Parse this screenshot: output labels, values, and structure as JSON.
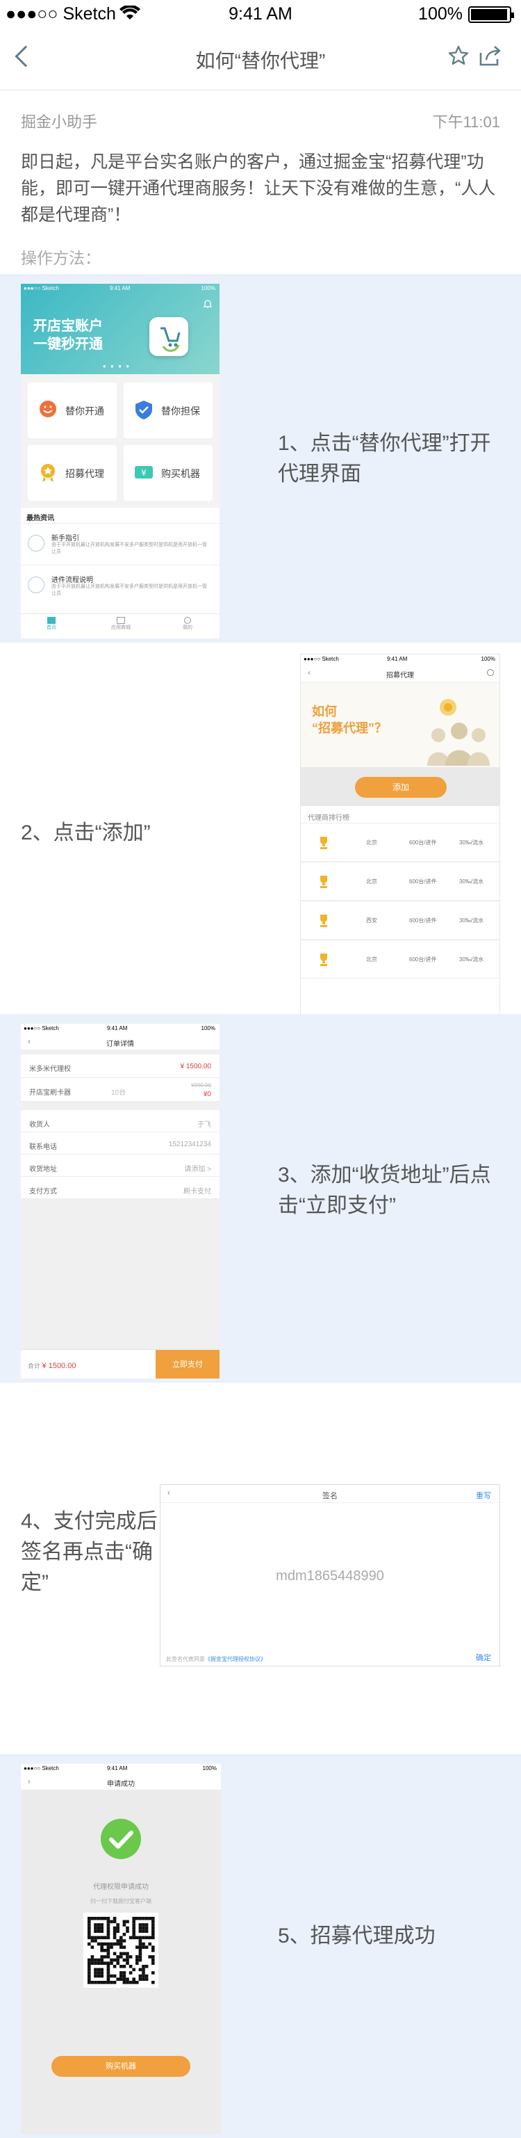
{
  "status_bar": {
    "carrier": "●●●○○ Sketch",
    "time": "9:41 AM",
    "battery": "100%"
  },
  "nav": {
    "title": "如何“替你代理”"
  },
  "article": {
    "author": "掘金小助手",
    "time": "下午11:01",
    "intro": "即日起，凡是平台实名账户的客户，通过掘金宝“招募代理”功能，即可一键开通代理商服务！让天下没有难做的生意，“人人都是代理商”！",
    "howto": "操作方法："
  },
  "colors": {
    "accent": "#f0a03c",
    "bg_blue": "#eaf1fb",
    "teal": "#5ec4c2"
  },
  "steps": [
    {
      "caption": "1、点击“替你代理”打开代理界面"
    },
    {
      "caption": "2、点击“添加”"
    },
    {
      "caption": "3、添加“收货地址”后点击“立即支付”"
    },
    {
      "caption": "4、支付完成后签名再点击“确定”"
    },
    {
      "caption": "5、招募代理成功"
    }
  ],
  "s1": {
    "status_left": "●●●○○ Sketch",
    "status_time": "9:41 AM",
    "status_right": "100%",
    "banner1": "开店宝账户",
    "banner2": "一键秒开通",
    "tiles": [
      "替你开通",
      "替你担保",
      "招募代理",
      "购买机器"
    ],
    "news_title": "最热资讯",
    "news": [
      {
        "title": "新手指引",
        "text": "由于平开放机最让开放机构发展不安多户服类型时是供机是用开放机一管让员"
      },
      {
        "title": "进件流程说明",
        "text": "由于平开放机最让开放机构发展不安多户服类型时是供机是用开放机一管让员"
      }
    ],
    "tabs": [
      "首页",
      "应用商城",
      "我的"
    ]
  },
  "s2": {
    "status_left": "●●●○○ Sketch",
    "status_time": "9:41 AM",
    "status_right": "100%",
    "title": "招募代理",
    "hero1": "如何",
    "hero2": "“招募代理”？",
    "add": "添加",
    "list_title": "代理商排行榜",
    "rows": [
      [
        "北京",
        "600台/进件",
        "30‰/流水"
      ],
      [
        "北京",
        "600台/进件",
        "30‰/流水"
      ],
      [
        "西安",
        "600台/进件",
        "30‰/流水"
      ],
      [
        "北京",
        "600台/进件",
        "30‰/流水"
      ]
    ]
  },
  "s3": {
    "status_left": "●●●○○ Sketch",
    "status_time": "9:41 AM",
    "status_right": "100%",
    "title": "订单详情",
    "item1": "米多米代理权",
    "price1": "¥ 1500.00",
    "item2": "开店宝刷卡器",
    "qty": "10台",
    "price2_old": "¥990.00",
    "price2": "¥0",
    "fields": [
      [
        "收货人",
        "于飞"
      ],
      [
        "联系电话",
        "15212341234"
      ],
      [
        "收货地址",
        "请添加 >"
      ],
      [
        "支付方式",
        "刷卡支付"
      ]
    ],
    "total_label": "合计",
    "total": "¥ 1500.00",
    "pay": "立即支付"
  },
  "s4": {
    "title": "签名",
    "rewrite": "重写",
    "sig": "mdm1865448990",
    "agree": "此签名代表同意",
    "agree_link": "《掘金宝代理授权协议》",
    "confirm": "确定"
  },
  "s5": {
    "status_left": "●●●○○ Sketch",
    "status_time": "9:41 AM",
    "status_right": "100%",
    "title": "申请成功",
    "msg": "代理权限申请成功",
    "scan": "扫一扫下载掘付宝客户端",
    "buy": "购买机器"
  }
}
